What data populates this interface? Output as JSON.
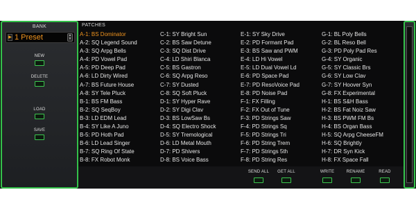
{
  "bank": {
    "title": "BANK",
    "selected": "1 Preset",
    "arrow": "▶"
  },
  "side_buttons": [
    "NEW",
    "DELETE",
    "LOAD",
    "SAVE"
  ],
  "patches": {
    "title": "PATCHES",
    "columns": [
      [
        "A-1: BS Dominator",
        "A-2: SQ Legend Sound",
        "A-3: SQ Arpg Bells",
        "A-4: PD Vowel Pad",
        "A-5: PD Deep Pad",
        "A-6: LD Dirty Wired",
        "A-7: BS Future House",
        "A-8: SY Tele Pluck",
        "B-1: BS FM Bass",
        "B-2: SQ SeqBoy",
        "B-3: LD EDM Lead",
        "B-4: SY Like A Juno",
        "B-5: PD Hoth Pad",
        "B-6: LD Lead Singer",
        "B-7: SQ Ring Of State",
        "B-8: FX Robot Monk"
      ],
      [
        "C-1: SY Bright Sun",
        "C-2: BS Saw Detune",
        "C-3: SQ Dist Drive",
        "C-4: LD Shiri Blanca",
        "C-5: BS Gastron",
        "C-6: SQ Arpg Reso",
        "C-7: SY Dusted",
        "C-8: SQ Soft Pluck",
        "D-1: SY Hyper Rave",
        "D-2: SY Digi Clav",
        "D-3: BS LowSaw Bs",
        "D-4: SQ Electro Shock",
        "D-5: SY Tremological",
        "D-6: LD Metal Mouth",
        "D-7: PD Shivers",
        "D-8: BS Voice Bass"
      ],
      [
        "E-1: SY Sky Drive",
        "E-2: PD Formant Pad",
        "E-3: BS Saw and PWM",
        "E-4: LD Hi Vowel",
        "E-5: LD Dual Vowel Ld",
        "E-6: PD Space Pad",
        "E-7: PD ResoVoice Pad",
        "E-8: PD Noise Pad",
        "F-1: FX Filling",
        "F-2: FX Out of Tune",
        "F-3: PD Strings Saw",
        "F-4: PD Strings Sq",
        "F-5: PD Strings Tri",
        "F-6: PD String Trem",
        "F-7: PD Strings 5th",
        "F-8: PD String Res"
      ],
      [
        "G-1: BL Poly Bells",
        "G-2: BL Reso Bell",
        "G-3: PD Poly Pad Res",
        "G-4: SY Organic",
        "G-5: SY Classic Brs",
        "G-6: SY Low Clav",
        "G-7: SY Hoover Syn",
        "G-8: FX Experimental",
        "H-1: BS S&H Bass",
        "H-2: BS Fat Noiz Saw",
        "H-3: BS PWM FM Bs",
        "H-4: BS Organ Bass",
        "H-5: SQ Arpg CheeseFM",
        "H-6: SQ Brightly",
        "H-7: DR Syn Kick",
        "H-8: FX Space Fall"
      ]
    ],
    "selected_index": [
      0,
      0
    ]
  },
  "bottom_buttons": [
    "SEND ALL",
    "GET ALL",
    "WRITE",
    "RENAME",
    "READ"
  ],
  "colors": {
    "accent_green": "#34c24a",
    "selected_orange": "#f0941f",
    "panel_bg": "#111214"
  }
}
